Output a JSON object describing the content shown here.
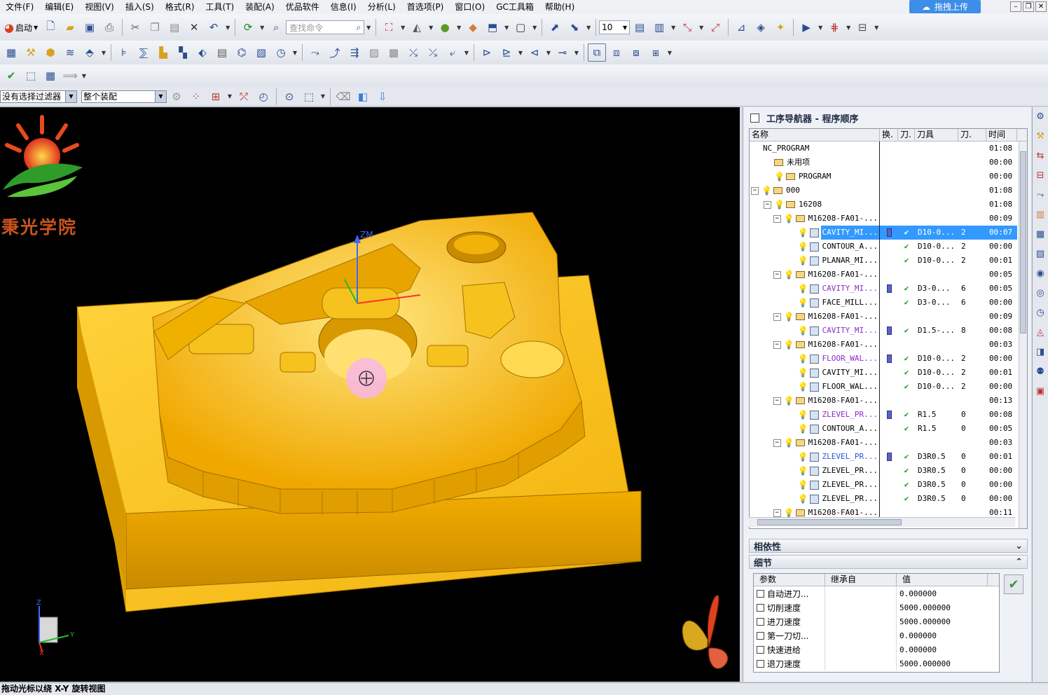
{
  "menubar": {
    "items": [
      "文件(F)",
      "编辑(E)",
      "视图(V)",
      "插入(S)",
      "格式(R)",
      "工具(T)",
      "装配(A)",
      "优品软件",
      "信息(I)",
      "分析(L)",
      "首选项(P)",
      "窗口(O)",
      "GC工具箱",
      "帮助(H)"
    ],
    "upload_button": "拖拽上传"
  },
  "toolbar": {
    "start_label": "启动",
    "search_placeholder": "查找命令",
    "number_value": "10"
  },
  "filterbar": {
    "selection_filter": "没有选择过滤器",
    "scope": "整个装配"
  },
  "viewport": {
    "logo_text": "秉光学院",
    "axis_zm": "ZM",
    "axis_z": "Z",
    "axis_y": "Y",
    "axis_x": "X",
    "colors": {
      "part": "#f2b20a",
      "part_dark": "#c88a00",
      "part_light": "#ffd23c",
      "background": "#000000",
      "cursor": "#f8b6e6"
    }
  },
  "navigator": {
    "title": "工序导航器 - 程序顺序",
    "columns": [
      "名称",
      "换.",
      "刀.",
      "刀具",
      "刀.",
      "时间"
    ],
    "rows": [
      {
        "indent": 0,
        "exp": "",
        "bulb": false,
        "icon": "none",
        "name": "NC_PROGRAM",
        "chg": "",
        "knife": "",
        "tool": "",
        "tnum": "",
        "time": "01:08",
        "style": ""
      },
      {
        "indent": 1,
        "exp": "",
        "bulb": false,
        "icon": "folder",
        "name": "未用项",
        "chg": "",
        "knife": "",
        "tool": "",
        "tnum": "",
        "time": "00:00",
        "style": ""
      },
      {
        "indent": 1,
        "exp": "",
        "bulb": true,
        "icon": "folder",
        "name": "PROGRAM",
        "chg": "",
        "knife": "",
        "tool": "",
        "tnum": "",
        "time": "00:00",
        "style": ""
      },
      {
        "indent": 0,
        "exp": "⊖",
        "bulb": true,
        "icon": "folder",
        "name": "000",
        "chg": "",
        "knife": "",
        "tool": "",
        "tnum": "",
        "time": "01:08",
        "style": ""
      },
      {
        "indent": 1,
        "exp": "⊖",
        "bulb": true,
        "icon": "folder",
        "name": "16208",
        "chg": "",
        "knife": "",
        "tool": "",
        "tnum": "",
        "time": "01:08",
        "style": ""
      },
      {
        "indent": 2,
        "exp": "⊖",
        "bulb": true,
        "icon": "folder",
        "name": "M16208-FA01-...",
        "chg": "",
        "knife": "",
        "tool": "",
        "tnum": "",
        "time": "00:09",
        "style": ""
      },
      {
        "indent": 3,
        "exp": "",
        "bulb": true,
        "icon": "op",
        "name": "CAVITY_MI...",
        "chg": "tp",
        "knife": "✔",
        "tool": "D10-0...",
        "tnum": "2",
        "time": "00:07",
        "style": "selected"
      },
      {
        "indent": 3,
        "exp": "",
        "bulb": true,
        "icon": "op",
        "name": "CONTOUR_A...",
        "chg": "",
        "knife": "✔",
        "tool": "D10-0...",
        "tnum": "2",
        "time": "00:00",
        "style": ""
      },
      {
        "indent": 3,
        "exp": "",
        "bulb": true,
        "icon": "op",
        "name": "PLANAR_MI...",
        "chg": "",
        "knife": "✔",
        "tool": "D10-0...",
        "tnum": "2",
        "time": "00:01",
        "style": ""
      },
      {
        "indent": 2,
        "exp": "⊖",
        "bulb": true,
        "icon": "folder",
        "name": "M16208-FA01-...",
        "chg": "",
        "knife": "",
        "tool": "",
        "tnum": "",
        "time": "00:05",
        "style": ""
      },
      {
        "indent": 3,
        "exp": "",
        "bulb": true,
        "icon": "op",
        "name": "CAVITY_MI...",
        "chg": "tp",
        "knife": "✔",
        "tool": "D3-0...",
        "tnum": "6",
        "time": "00:05",
        "style": "purple"
      },
      {
        "indent": 3,
        "exp": "",
        "bulb": true,
        "icon": "op",
        "name": "FACE_MILL...",
        "chg": "",
        "knife": "✔",
        "tool": "D3-0...",
        "tnum": "6",
        "time": "00:00",
        "style": ""
      },
      {
        "indent": 2,
        "exp": "⊖",
        "bulb": true,
        "icon": "folder",
        "name": "M16208-FA01-...",
        "chg": "",
        "knife": "",
        "tool": "",
        "tnum": "",
        "time": "00:09",
        "style": ""
      },
      {
        "indent": 3,
        "exp": "",
        "bulb": true,
        "icon": "op",
        "name": "CAVITY_MI...",
        "chg": "tp",
        "knife": "✔",
        "tool": "D1.5-...",
        "tnum": "8",
        "time": "00:08",
        "style": "purple"
      },
      {
        "indent": 2,
        "exp": "⊖",
        "bulb": true,
        "icon": "folder",
        "name": "M16208-FA01-...",
        "chg": "",
        "knife": "",
        "tool": "",
        "tnum": "",
        "time": "00:03",
        "style": ""
      },
      {
        "indent": 3,
        "exp": "",
        "bulb": true,
        "icon": "op",
        "name": "FLOOR_WAL...",
        "chg": "tp",
        "knife": "✔",
        "tool": "D10-0...",
        "tnum": "2",
        "time": "00:00",
        "style": "purple"
      },
      {
        "indent": 3,
        "exp": "",
        "bulb": true,
        "icon": "op",
        "name": "CAVITY_MI...",
        "chg": "",
        "knife": "✔",
        "tool": "D10-0...",
        "tnum": "2",
        "time": "00:01",
        "style": ""
      },
      {
        "indent": 3,
        "exp": "",
        "bulb": true,
        "icon": "op",
        "name": "FLOOR_WAL...",
        "chg": "",
        "knife": "✔",
        "tool": "D10-0...",
        "tnum": "2",
        "time": "00:00",
        "style": ""
      },
      {
        "indent": 2,
        "exp": "⊖",
        "bulb": true,
        "icon": "folder",
        "name": "M16208-FA01-...",
        "chg": "",
        "knife": "",
        "tool": "",
        "tnum": "",
        "time": "00:13",
        "style": ""
      },
      {
        "indent": 3,
        "exp": "",
        "bulb": true,
        "icon": "op",
        "name": "ZLEVEL_PR...",
        "chg": "tp",
        "knife": "✔",
        "tool": "R1.5",
        "tnum": "0",
        "time": "00:08",
        "style": "purple"
      },
      {
        "indent": 3,
        "exp": "",
        "bulb": true,
        "icon": "op",
        "name": "CONTOUR_A...",
        "chg": "",
        "knife": "✔",
        "tool": "R1.5",
        "tnum": "0",
        "time": "00:05",
        "style": ""
      },
      {
        "indent": 2,
        "exp": "⊖",
        "bulb": true,
        "icon": "folder",
        "name": "M16208-FA01-...",
        "chg": "",
        "knife": "",
        "tool": "",
        "tnum": "",
        "time": "00:03",
        "style": ""
      },
      {
        "indent": 3,
        "exp": "",
        "bulb": true,
        "icon": "op",
        "name": "ZLEVEL_PR...",
        "chg": "tp",
        "knife": "✔",
        "tool": "D3R0.5",
        "tnum": "0",
        "time": "00:01",
        "style": "blue"
      },
      {
        "indent": 3,
        "exp": "",
        "bulb": true,
        "icon": "op",
        "name": "ZLEVEL_PR...",
        "chg": "",
        "knife": "✔",
        "tool": "D3R0.5",
        "tnum": "0",
        "time": "00:00",
        "style": ""
      },
      {
        "indent": 3,
        "exp": "",
        "bulb": true,
        "icon": "op",
        "name": "ZLEVEL_PR...",
        "chg": "",
        "knife": "✔",
        "tool": "D3R0.5",
        "tnum": "0",
        "time": "00:00",
        "style": ""
      },
      {
        "indent": 3,
        "exp": "",
        "bulb": true,
        "icon": "op",
        "name": "ZLEVEL_PR...",
        "chg": "",
        "knife": "✔",
        "tool": "D3R0.5",
        "tnum": "0",
        "time": "00:00",
        "style": ""
      },
      {
        "indent": 2,
        "exp": "⊖",
        "bulb": true,
        "icon": "folder",
        "name": "M16208-FA01-...",
        "chg": "",
        "knife": "",
        "tool": "",
        "tnum": "",
        "time": "00:11",
        "style": ""
      }
    ]
  },
  "dependency": {
    "title": "相依性"
  },
  "details": {
    "title": "细节",
    "columns": [
      "参数",
      "继承自",
      "值"
    ],
    "rows": [
      {
        "name": "自动进刀...",
        "value": "0.000000"
      },
      {
        "name": "切削速度",
        "value": "5000.000000"
      },
      {
        "name": "进刀速度",
        "value": "5000.000000"
      },
      {
        "name": "第一刀切...",
        "value": "0.000000"
      },
      {
        "name": "快速进给",
        "value": "0.000000"
      },
      {
        "name": "退刀速度",
        "value": "5000.000000"
      }
    ]
  },
  "statusbar": {
    "text": "拖动光标以绕 X-Y 旋转视图"
  }
}
